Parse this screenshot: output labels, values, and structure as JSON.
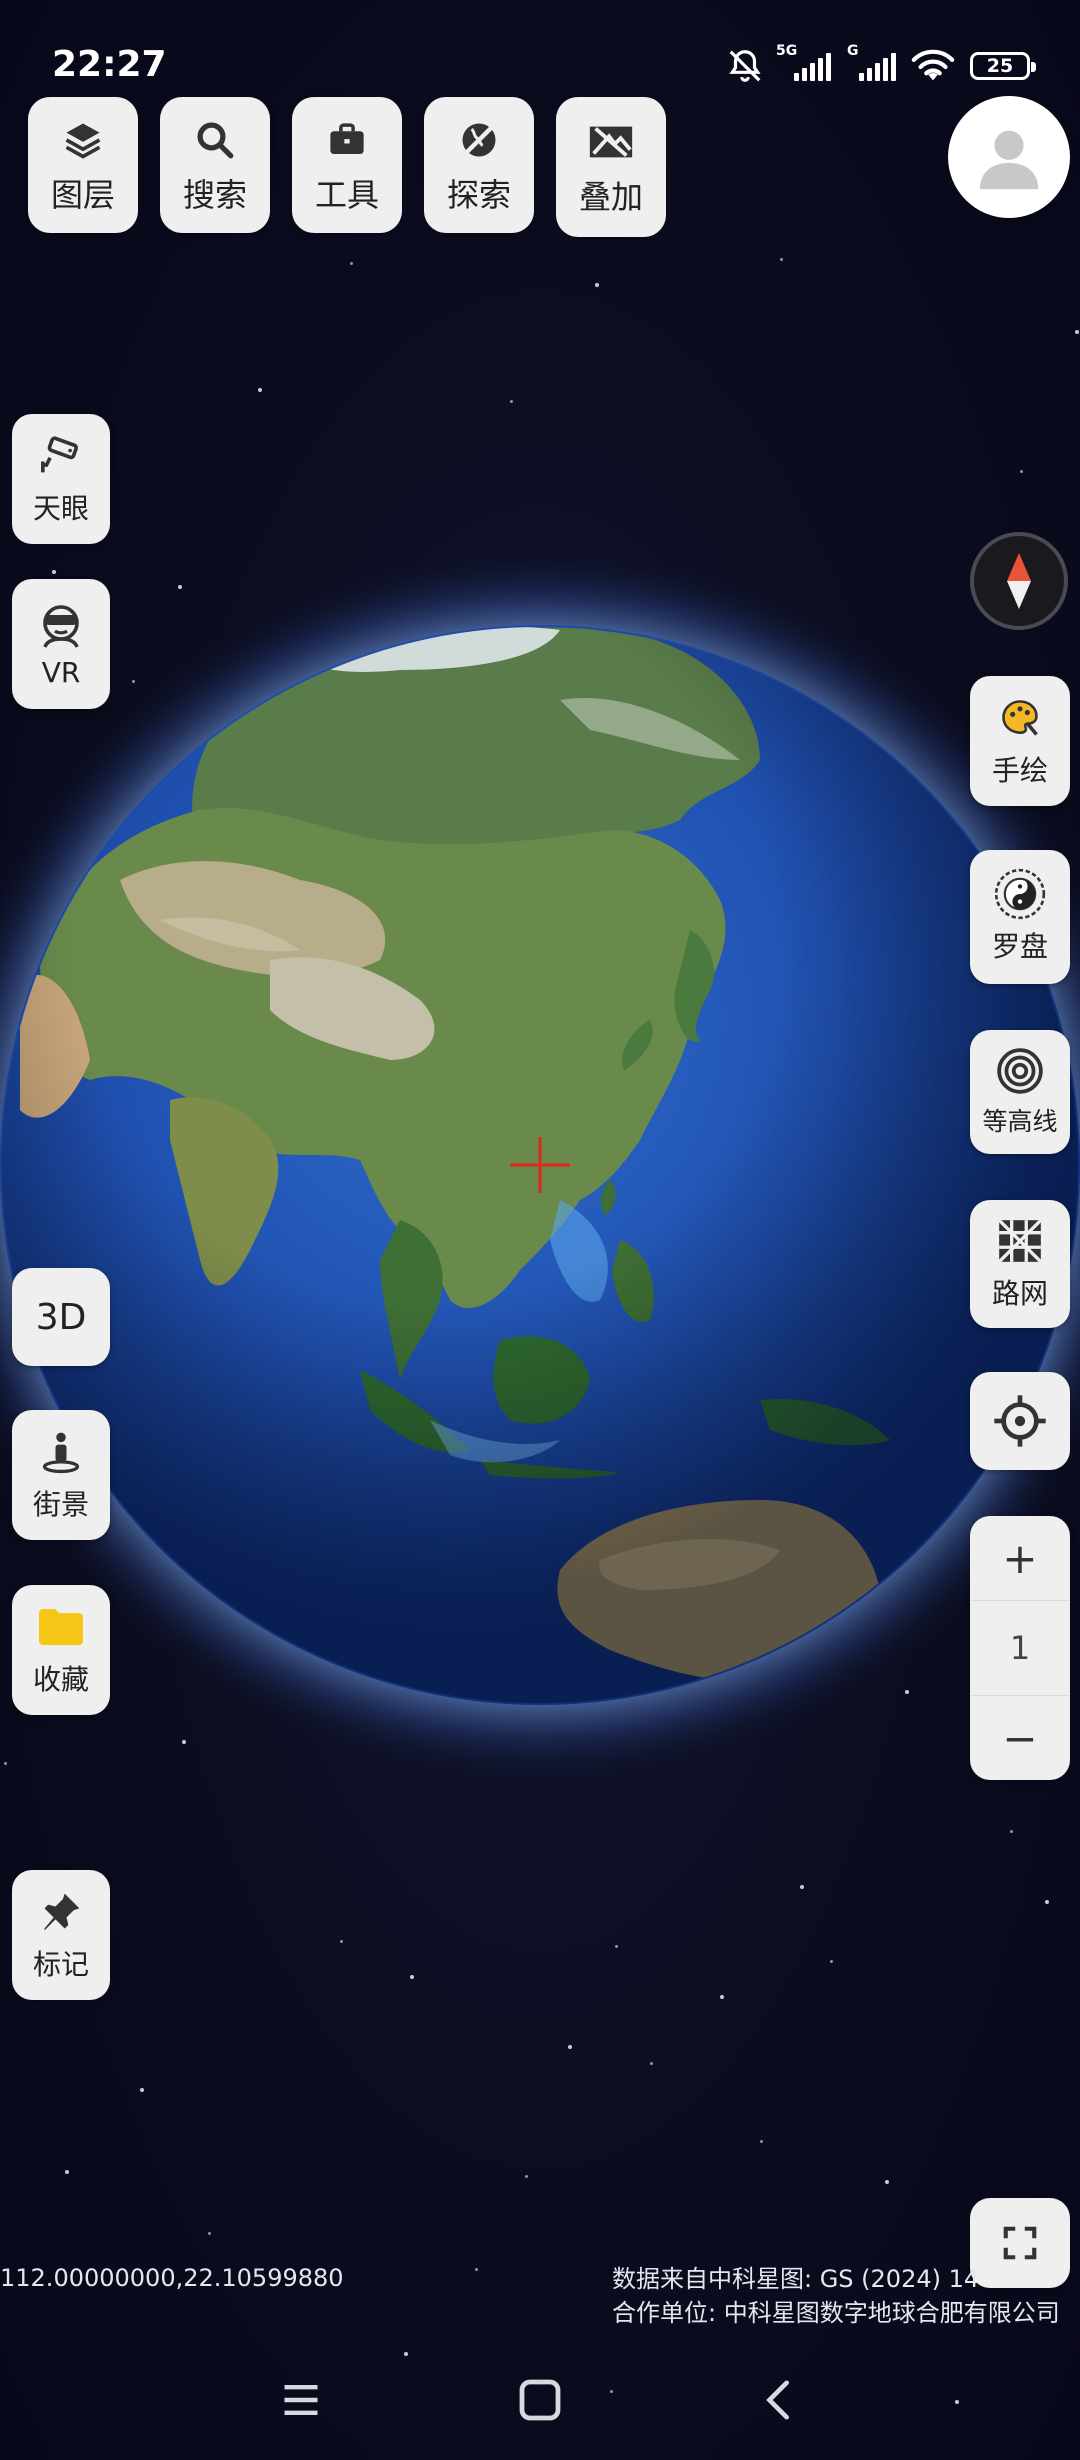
{
  "status_bar": {
    "time": "22:27",
    "network_1": "5G",
    "network_2": "G",
    "battery": "25"
  },
  "toolbar": {
    "layers_label": "图层",
    "search_label": "搜索",
    "tools_label": "工具",
    "explore_label": "探索",
    "overlay_label": "叠加"
  },
  "left_panel": {
    "sky_eye_label": "天眼",
    "vr_label": "VR",
    "mode_3d_label": "3D",
    "street_view_label": "街景",
    "favorites_label": "收藏",
    "marker_label": "标记"
  },
  "right_panel": {
    "hand_draw_label": "手绘",
    "compass_tool_label": "罗盘",
    "contour_label": "等高线",
    "road_net_label": "路网"
  },
  "zoom": {
    "plus": "+",
    "level": "1",
    "minus": "−"
  },
  "footer": {
    "coordinates": "112.00000000,22.10599880",
    "credit_line1": "数据来自中科星图: GS (2024) 14",
    "credit_line2": "合作单位: 中科星图数字地球合肥有限公司"
  },
  "icons": {
    "layers": "layers-icon",
    "search": "search-icon",
    "tools": "briefcase-icon",
    "explore": "globe-slash-icon",
    "overlay": "overlay-icon",
    "avatar": "user-icon",
    "sky_eye": "camera-icon",
    "vr": "vr-headset-icon",
    "compass": "compass-needle-icon",
    "hand_draw": "palette-icon",
    "luopan": "bagua-icon",
    "contour": "contour-icon",
    "road_net": "grid-icon",
    "locate": "locate-icon",
    "street_view": "pegman-icon",
    "favorites": "folder-icon",
    "marker": "pin-icon",
    "fullscreen": "fullscreen-icon"
  },
  "colors": {
    "space_background": "#0b0d1e",
    "button_background": "#efefef",
    "crosshair": "#e0281e",
    "compass_north": "#e8533a"
  }
}
